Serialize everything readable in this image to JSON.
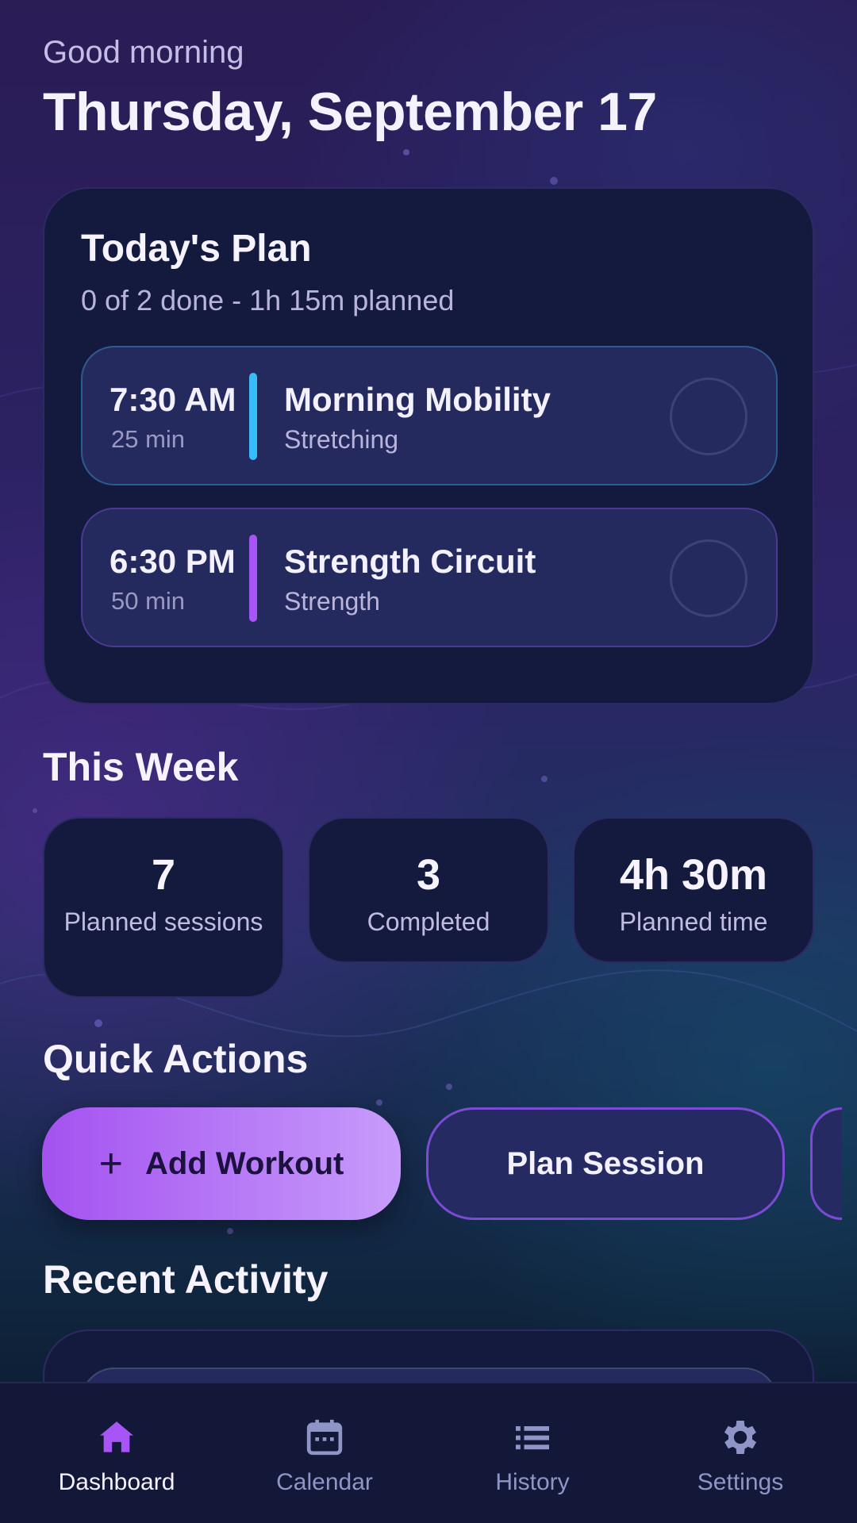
{
  "header": {
    "greeting": "Good morning",
    "date": "Thursday, September 17"
  },
  "todays_plan": {
    "title": "Today's Plan",
    "summary": "0 of 2 done - 1h 15m planned",
    "sessions": [
      {
        "time": "7:30 AM",
        "duration": "25 min",
        "name": "Morning Mobility",
        "type": "Stretching",
        "color": "#38bdf8",
        "done": false
      },
      {
        "time": "6:30 PM",
        "duration": "50 min",
        "name": "Strength Circuit",
        "type": "Strength",
        "color": "#a855f7",
        "done": false
      }
    ]
  },
  "this_week": {
    "title": "This Week",
    "stats": [
      {
        "value": "7",
        "label": "Planned sessions"
      },
      {
        "value": "3",
        "label": "Completed"
      },
      {
        "value": "4h 30m",
        "label": "Planned time"
      }
    ]
  },
  "quick_actions": {
    "title": "Quick Actions",
    "add_workout": "Add Workout",
    "add_icon": "plus-icon",
    "plan_session": "Plan Session"
  },
  "recent_activity": {
    "title": "Recent Activity"
  },
  "nav": {
    "items": [
      {
        "label": "Dashboard",
        "icon": "home-icon",
        "active": true
      },
      {
        "label": "Calendar",
        "icon": "calendar-icon",
        "active": false
      },
      {
        "label": "History",
        "icon": "list-icon",
        "active": false
      },
      {
        "label": "Settings",
        "icon": "gear-icon",
        "active": false
      }
    ]
  },
  "colors": {
    "accent": "#a855f7",
    "nav_inactive": "#8f95c6",
    "card": "#141a3e"
  }
}
